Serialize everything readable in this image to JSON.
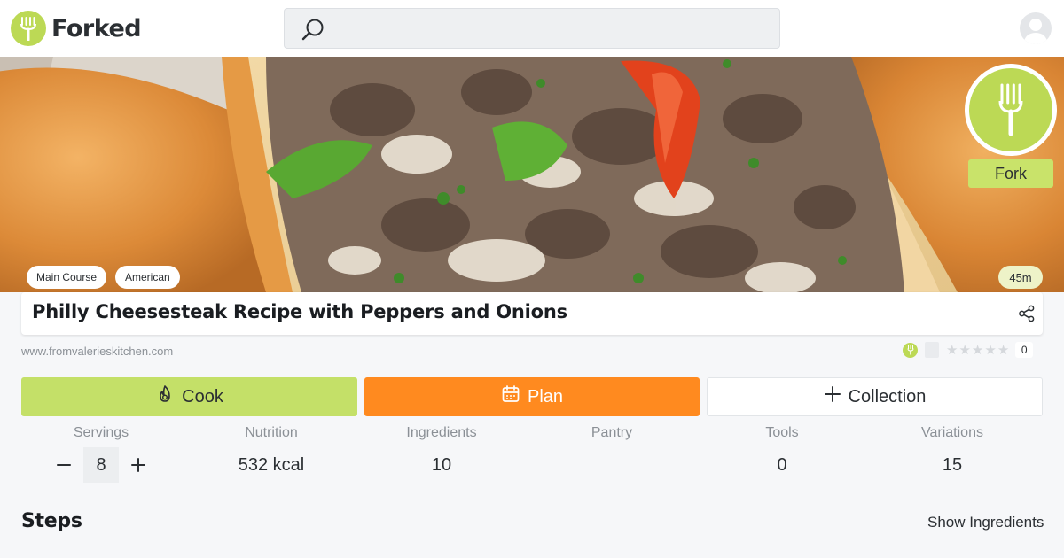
{
  "app": {
    "name": "Forked"
  },
  "search": {
    "placeholder": ""
  },
  "hero": {
    "fork_label": "Fork",
    "tags": [
      "Main Course",
      "American"
    ],
    "time": "45m"
  },
  "recipe": {
    "title": "Philly Cheesesteak Recipe with Peppers and Onions",
    "source": "www.fromvalerieskitchen.com",
    "rating_stars": 0,
    "rating_count": "0"
  },
  "actions": {
    "cook": "Cook",
    "plan": "Plan",
    "collection": "Collection"
  },
  "stats": {
    "servings_label": "Servings",
    "servings_value": "8",
    "nutrition_label": "Nutrition",
    "nutrition_value": "532 kcal",
    "ingredients_label": "Ingredients",
    "ingredients_value": "10",
    "pantry_label": "Pantry",
    "pantry_value": "",
    "tools_label": "Tools",
    "tools_value": "0",
    "variations_label": "Variations",
    "variations_value": "15"
  },
  "steps": {
    "heading": "Steps",
    "show_ingredients": "Show Ingredients"
  },
  "colors": {
    "brand_green": "#bcd955",
    "plan_orange": "#ff8a1f",
    "cook_green": "#c4e068"
  }
}
